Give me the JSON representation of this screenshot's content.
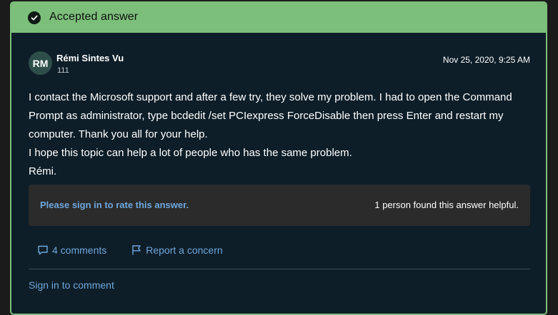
{
  "banner": {
    "label": "Accepted answer",
    "icon": "check-circle-icon",
    "color": "#7cbf7a"
  },
  "author": {
    "initials": "RM",
    "name": "Rémi Sintes Vu",
    "reputation": "111"
  },
  "post": {
    "date": "Nov 25, 2020, 9:25 AM",
    "paragraphs": [
      "I contact the Microsoft support and after a few try, they solve my problem. I had to open the Command Prompt as administrator, type bcdedit /set PCIexpress ForceDisable then press Enter and restart my computer. Thank you all for your help.",
      "I hope this topic can help a lot of people who has the same problem.",
      "Rémi."
    ]
  },
  "rating": {
    "sign_in_label": "Please sign in to rate this answer.",
    "helpful_text": "1 person found this answer helpful."
  },
  "actions": {
    "comments_label": "4 comments",
    "comments_icon": "comment-icon",
    "report_label": "Report a concern",
    "report_icon": "flag-icon"
  },
  "footer": {
    "sign_in_label": "Sign in to comment"
  },
  "colors": {
    "card_bg": "#0e1e28",
    "link": "#6ea7dd",
    "rate_box_bg": "#2b2b2b"
  }
}
